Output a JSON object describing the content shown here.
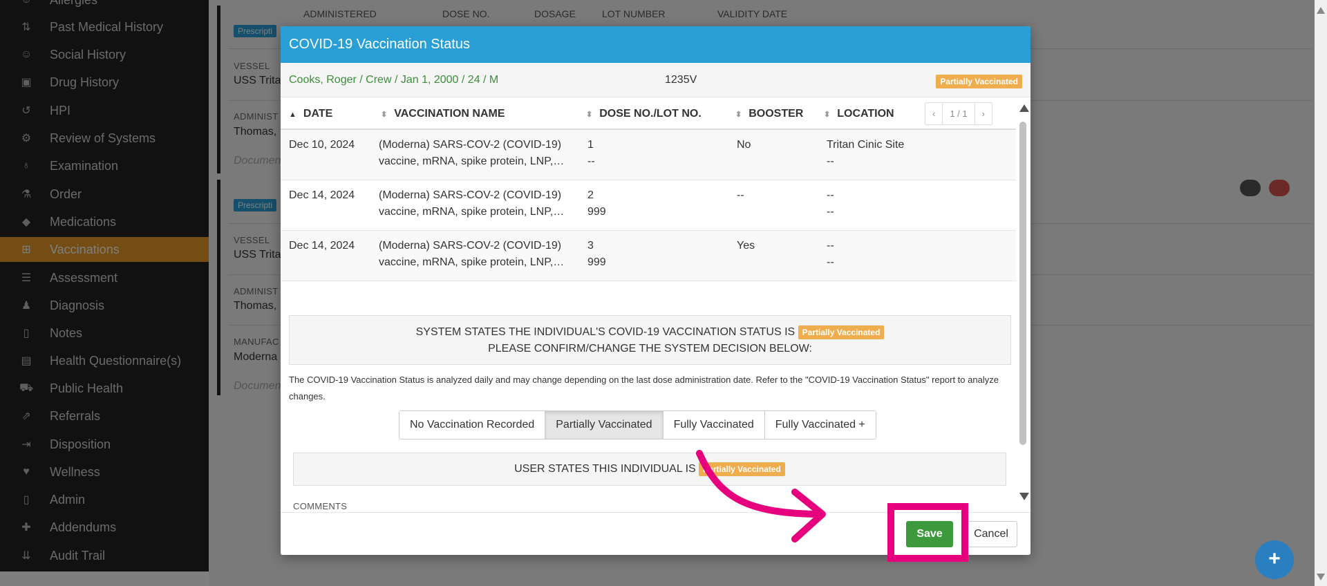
{
  "sidebar": {
    "items": [
      {
        "label": "Allergies",
        "icon": "smiley-icon"
      },
      {
        "label": "Past Medical History",
        "icon": "sort-icon"
      },
      {
        "label": "Social History",
        "icon": "smiley-icon"
      },
      {
        "label": "Drug History",
        "icon": "medkit-icon"
      },
      {
        "label": "HPI",
        "icon": "history-icon"
      },
      {
        "label": "Review of Systems",
        "icon": "gear-icon"
      },
      {
        "label": "Examination",
        "icon": "stethoscope-icon"
      },
      {
        "label": "Order",
        "icon": "flask-icon"
      },
      {
        "label": "Medications",
        "icon": "pill-icon"
      },
      {
        "label": "Vaccinations",
        "icon": "plus-square-icon"
      },
      {
        "label": "Assessment",
        "icon": "list-icon"
      },
      {
        "label": "Diagnosis",
        "icon": "user-md-icon"
      },
      {
        "label": "Notes",
        "icon": "file-icon"
      },
      {
        "label": "Health Questionnaire(s)",
        "icon": "clipboard-icon"
      },
      {
        "label": "Public Health",
        "icon": "ambulance-icon"
      },
      {
        "label": "Referrals",
        "icon": "share-square-icon"
      },
      {
        "label": "Disposition",
        "icon": "sign-out-icon"
      },
      {
        "label": "Wellness",
        "icon": "heartbeat-icon"
      },
      {
        "label": "Admin",
        "icon": "file-icon"
      },
      {
        "label": "Addendums",
        "icon": "plus-icon"
      },
      {
        "label": "Audit Trail",
        "icon": "sort-amount-icon"
      }
    ]
  },
  "background": {
    "headers": [
      "ADMINISTERED",
      "DOSE NO.",
      "DOSAGE",
      "LOT NUMBER",
      "VALIDITY DATE"
    ],
    "prescription_badge": "Prescripti",
    "vessel_label": "VESSEL",
    "vessel_value": "USS Trita",
    "admin_label": "ADMINIST",
    "admin_value": "Thomas,",
    "manufacturer_label": "MANUFAC",
    "manufacturer_value": "Moderna",
    "document_placeholder": "Documen"
  },
  "modal": {
    "title": "COVID-19 Vaccination Status",
    "patient": {
      "name": "Cooks, Roger / Crew / Jan 1, 2000 / 24 / M",
      "id": "1235V",
      "status": "Partially Vaccinated"
    },
    "table": {
      "columns": [
        "DATE",
        "VACCINATION NAME",
        "DOSE NO./LOT NO.",
        "BOOSTER",
        "LOCATION"
      ],
      "pager": {
        "prev": "‹",
        "page": "1 / 1",
        "next": "›"
      },
      "rows": [
        {
          "date": "Dec 10, 2024",
          "name1": "(Moderna) SARS-COV-2 (COVID-19)",
          "name2": "vaccine, mRNA, spike protein, LNP,…",
          "dose": "1",
          "lot": "--",
          "booster": "No",
          "location1": "Tritan Cinic Site",
          "location2": "--"
        },
        {
          "date": "Dec 14, 2024",
          "name1": "(Moderna) SARS-COV-2 (COVID-19)",
          "name2": "vaccine, mRNA, spike protein, LNP,…",
          "dose": "2",
          "lot": "999",
          "booster": "--",
          "location1": "--",
          "location2": "--"
        },
        {
          "date": "Dec 14, 2024",
          "name1": "(Moderna) SARS-COV-2 (COVID-19)",
          "name2": "vaccine, mRNA, spike protein, LNP,…",
          "dose": "3",
          "lot": "999",
          "booster": "Yes",
          "location1": "--",
          "location2": "--"
        }
      ]
    },
    "system_statement": "SYSTEM STATES THE INDIVIDUAL'S COVID-19 VACCINATION STATUS IS",
    "system_status": "Partially Vaccinated",
    "confirm_text": "PLEASE CONFIRM/CHANGE THE SYSTEM DECISION BELOW:",
    "note": "The COVID-19 Vaccination Status is analyzed daily and may change depending on the last dose administration date. Refer to the \"COVID-19 Vaccination Status\" report to analyze changes.",
    "options": [
      "No Vaccination Recorded",
      "Partially Vaccinated",
      "Fully Vaccinated",
      "Fully Vaccinated +"
    ],
    "selected_option": "Partially Vaccinated",
    "user_statement": "USER STATES THIS INDIVIDUAL IS",
    "user_status": "Partially Vaccinated",
    "comments_label": "COMMENTS",
    "comments_value": "",
    "save_label": "Save",
    "cancel_label": "Cancel"
  },
  "fab_label": "+",
  "colors": {
    "primary": "#2a9fd6",
    "active_nav": "#e79b27",
    "status_badge": "#f0ad4e",
    "save": "#3c9a3c",
    "annotation": "#e6007e",
    "sidebar_bg": "#222222"
  }
}
